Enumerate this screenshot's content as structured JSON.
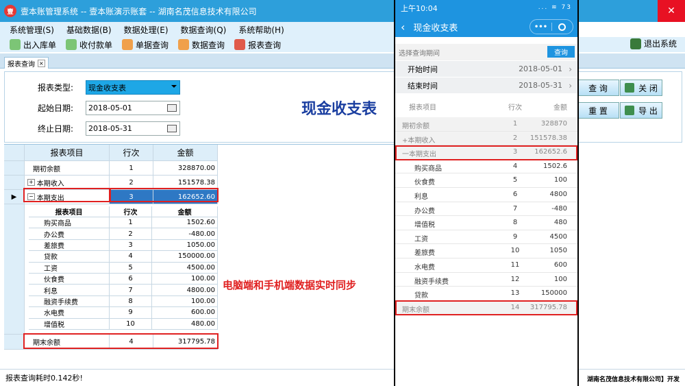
{
  "window": {
    "title": "壹本账管理系统 -- 壹本账演示账套 -- 湖南名茂信息技术有限公司",
    "logo": "壹"
  },
  "menu": [
    "系统管理(S)",
    "基础数据(B)",
    "数据处理(E)",
    "数据查询(Q)",
    "系统帮助(H)"
  ],
  "toolbar": [
    {
      "label": "出入库单",
      "icon": "inventory-icon",
      "color": "#7cc576"
    },
    {
      "label": "收付款单",
      "icon": "payment-icon",
      "color": "#7cc576"
    },
    {
      "label": "单据查询",
      "icon": "document-query-icon",
      "color": "#f0a04b"
    },
    {
      "label": "数据查询",
      "icon": "chart-icon",
      "color": "#f0a04b"
    },
    {
      "label": "报表查询",
      "icon": "report-icon",
      "color": "#e05a4a"
    }
  ],
  "exit_label": "退出系统",
  "tab": {
    "label": "报表查询",
    "close": "×"
  },
  "form": {
    "report_type_label": "报表类型:",
    "report_type_value": "现金收支表",
    "start_label": "起始日期:",
    "start_value": "2018-05-01",
    "end_label": "终止日期:",
    "end_value": "2018-05-31"
  },
  "big_title": "现金收支表",
  "buttons": {
    "query": "查 询",
    "close": "关 闭",
    "reset": "重 置",
    "export": "导 出"
  },
  "grid": {
    "headers": [
      "报表项目",
      "行次",
      "金额"
    ],
    "rows": [
      {
        "name": "期初余额",
        "line": "1",
        "amount": "328870.00"
      },
      {
        "name": "本期收入",
        "line": "2",
        "amount": "151578.38",
        "expander": "+"
      },
      {
        "name": "本期支出",
        "line": "3",
        "amount": "162652.60",
        "expander": "−"
      }
    ],
    "sub_headers": [
      "报表项目",
      "行次",
      "金额"
    ],
    "sub_rows": [
      {
        "name": "购买商品",
        "line": "1",
        "amount": "1502.60"
      },
      {
        "name": "办公费",
        "line": "2",
        "amount": "-480.00"
      },
      {
        "name": "差旅费",
        "line": "3",
        "amount": "1050.00"
      },
      {
        "name": "贷款",
        "line": "4",
        "amount": "150000.00"
      },
      {
        "name": "工资",
        "line": "5",
        "amount": "4500.00"
      },
      {
        "name": "伙食费",
        "line": "6",
        "amount": "100.00"
      },
      {
        "name": "利息",
        "line": "7",
        "amount": "4800.00"
      },
      {
        "name": "融资手续费",
        "line": "8",
        "amount": "100.00"
      },
      {
        "name": "水电费",
        "line": "9",
        "amount": "600.00"
      },
      {
        "name": "增值税",
        "line": "10",
        "amount": "480.00"
      }
    ],
    "footer": {
      "name": "期末余额",
      "line": "4",
      "amount": "317795.78"
    }
  },
  "sync_note": "电脑端和手机端数据实时同步",
  "status": "报表查询耗时0.142秒!",
  "credit": "湖南名茂信息技术有限公司】开发",
  "phone": {
    "time": "上午10:04",
    "status_icons": "... ≋ 73",
    "title": "现金收支表",
    "capsule_more": "•••",
    "period_label": "选择查询期间",
    "query_btn": "查询",
    "start_label": "开始时间",
    "start_value": "2018-05-01",
    "end_label": "结束时间",
    "end_value": "2018-05-31",
    "headers": [
      "报表项目",
      "行次",
      "金额"
    ],
    "rows": [
      {
        "name": "期初余额",
        "line": "1",
        "amount": "328870",
        "kind": "gray"
      },
      {
        "name": "+本期收入",
        "line": "2",
        "amount": "151578.38",
        "kind": "gray"
      },
      {
        "name": "一本期支出",
        "line": "3",
        "amount": "162652.6",
        "kind": "gray"
      },
      {
        "name": "购买商品",
        "line": "4",
        "amount": "1502.6",
        "kind": "detail"
      },
      {
        "name": "伙食费",
        "line": "5",
        "amount": "100",
        "kind": "detail"
      },
      {
        "name": "利息",
        "line": "6",
        "amount": "4800",
        "kind": "detail"
      },
      {
        "name": "办公费",
        "line": "7",
        "amount": "-480",
        "kind": "detail"
      },
      {
        "name": "增值税",
        "line": "8",
        "amount": "480",
        "kind": "detail"
      },
      {
        "name": "工资",
        "line": "9",
        "amount": "4500",
        "kind": "detail"
      },
      {
        "name": "差旅费",
        "line": "10",
        "amount": "1050",
        "kind": "detail"
      },
      {
        "name": "水电费",
        "line": "11",
        "amount": "600",
        "kind": "detail"
      },
      {
        "name": "融资手续费",
        "line": "12",
        "amount": "100",
        "kind": "detail"
      },
      {
        "name": "贷款",
        "line": "13",
        "amount": "150000",
        "kind": "detail"
      },
      {
        "name": "期末余额",
        "line": "14",
        "amount": "317795.78",
        "kind": "gray"
      }
    ]
  },
  "colors": {
    "titlebar": "#2d9fdb",
    "accent": "#1e94e0",
    "highlight": "#e02020",
    "selected": "#2e78c4"
  }
}
